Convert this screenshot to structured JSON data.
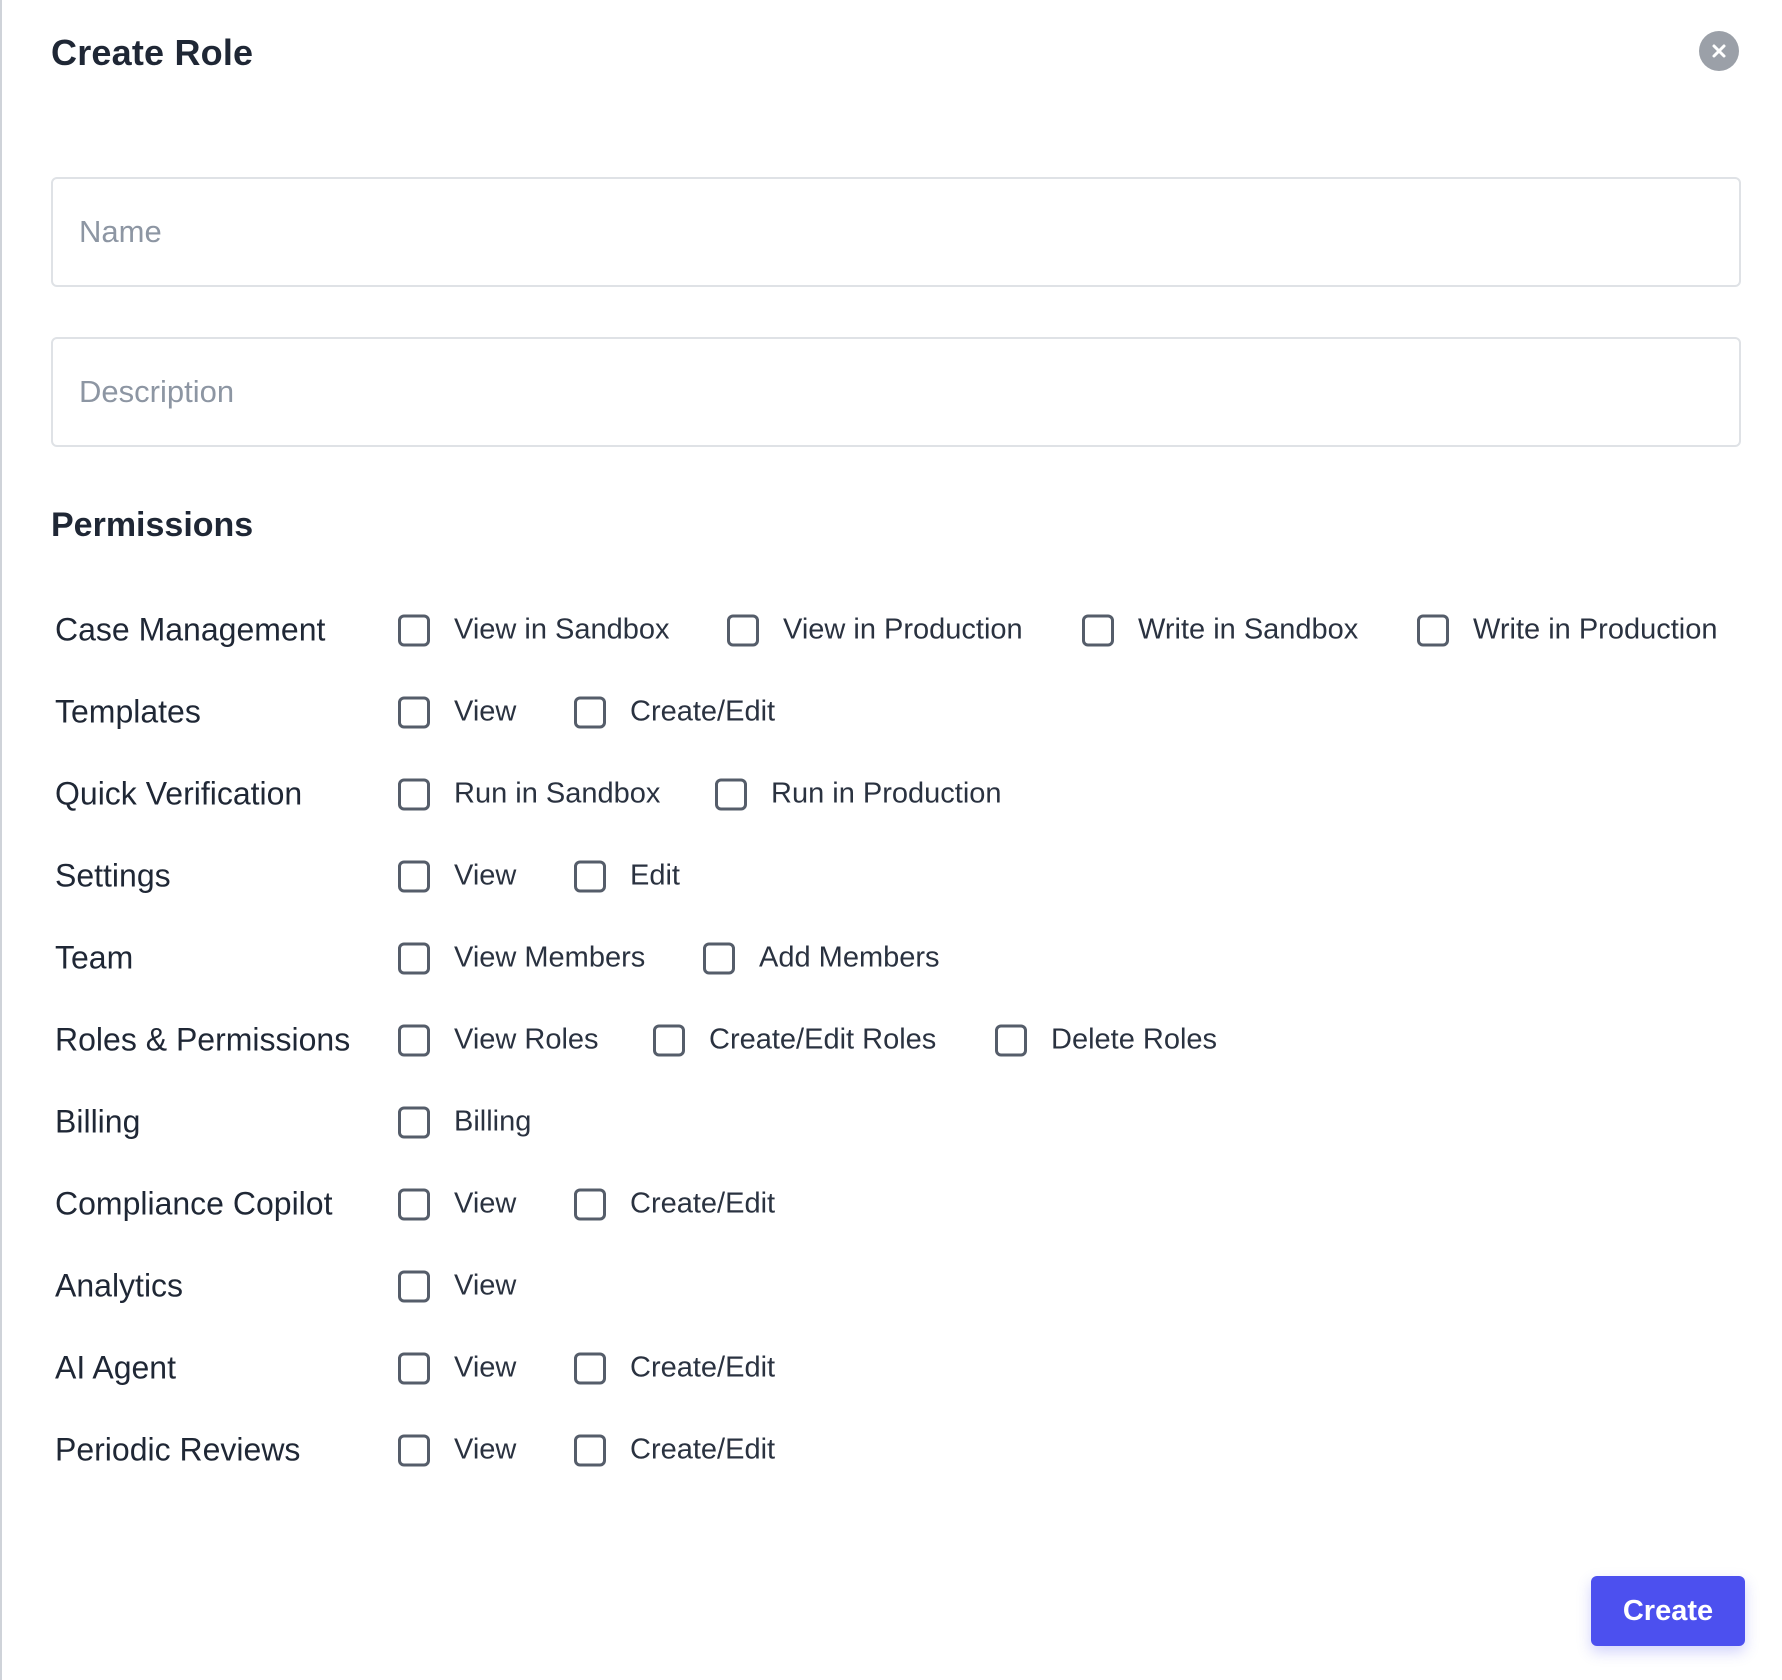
{
  "dialog": {
    "title": "Create Role",
    "close_icon": "close-icon",
    "name_placeholder": "Name",
    "description_placeholder": "Description",
    "permissions_title": "Permissions",
    "create_label": "Create"
  },
  "colors": {
    "accent": "#4c50ef",
    "text": "#1f2735",
    "placeholder": "#8d96a3",
    "border": "#dfe2e6",
    "checkbox_border": "#555d6a",
    "close_bg": "#9ba0a8"
  },
  "permissions": [
    {
      "label": "Case Management",
      "options": [
        "View in Sandbox",
        "View in Production",
        "Write in Sandbox",
        "Write in Production"
      ]
    },
    {
      "label": "Templates",
      "options": [
        "View",
        "Create/Edit"
      ]
    },
    {
      "label": "Quick Verification",
      "options": [
        "Run in Sandbox",
        "Run in Production"
      ]
    },
    {
      "label": "Settings",
      "options": [
        "View",
        "Edit"
      ]
    },
    {
      "label": "Team",
      "options": [
        "View Members",
        "Add Members"
      ]
    },
    {
      "label": "Roles & Permissions",
      "options": [
        "View Roles",
        "Create/Edit Roles",
        "Delete Roles"
      ]
    },
    {
      "label": "Billing",
      "options": [
        "Billing"
      ]
    },
    {
      "label": "Compliance Copilot",
      "options": [
        "View",
        "Create/Edit"
      ]
    },
    {
      "label": "Analytics",
      "options": [
        "View"
      ]
    },
    {
      "label": "AI Agent",
      "options": [
        "View",
        "Create/Edit"
      ]
    },
    {
      "label": "Periodic Reviews",
      "options": [
        "View",
        "Create/Edit"
      ]
    }
  ]
}
